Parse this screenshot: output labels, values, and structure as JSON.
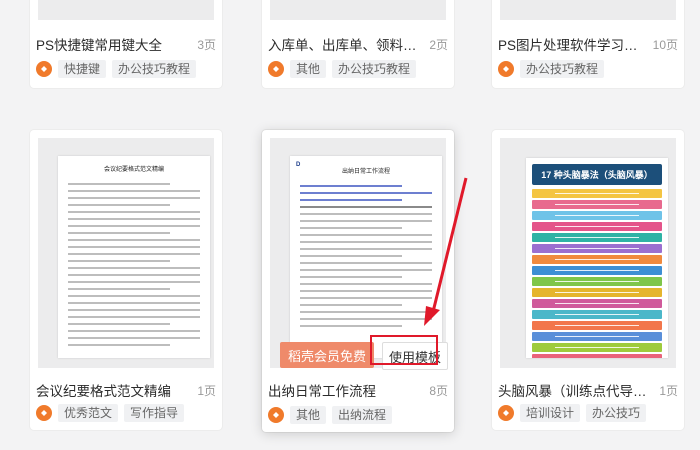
{
  "colors": {
    "accent": "#f07a2b",
    "vip_button": "#ef8a6a",
    "highlight": "#e0192a",
    "arrow": "#e0192a"
  },
  "cards": [
    {
      "title": "PS快捷键常用键大全",
      "pages": "3页",
      "tags": [
        "快捷键",
        "办公技巧教程"
      ]
    },
    {
      "title": "入库单、出库单、领料…",
      "pages": "2页",
      "tags": [
        "其他",
        "办公技巧教程"
      ]
    },
    {
      "title": "PS图片处理软件学习…",
      "pages": "10页",
      "tags": [
        "办公技巧教程"
      ]
    },
    {
      "title": "会议纪要格式范文精编",
      "pages": "1页",
      "tags": [
        "优秀范文",
        "写作指导"
      ],
      "preview_title": "会议纪要格式范文精编"
    },
    {
      "title": "出纳日常工作流程",
      "pages": "8页",
      "tags": [
        "其他",
        "出纳流程"
      ],
      "preview_title": "出纳日常工作流程",
      "vip_button": "稻壳会员免费",
      "use_button": "使用模板"
    },
    {
      "title": "头脑风暴（训练点代导…",
      "pages": "1页",
      "tags": [
        "培训设计",
        "办公技巧"
      ],
      "preview_title": "17 种头脑暴法（头脑风暴）"
    }
  ],
  "icons": {
    "badge": "docer-badge-icon"
  }
}
